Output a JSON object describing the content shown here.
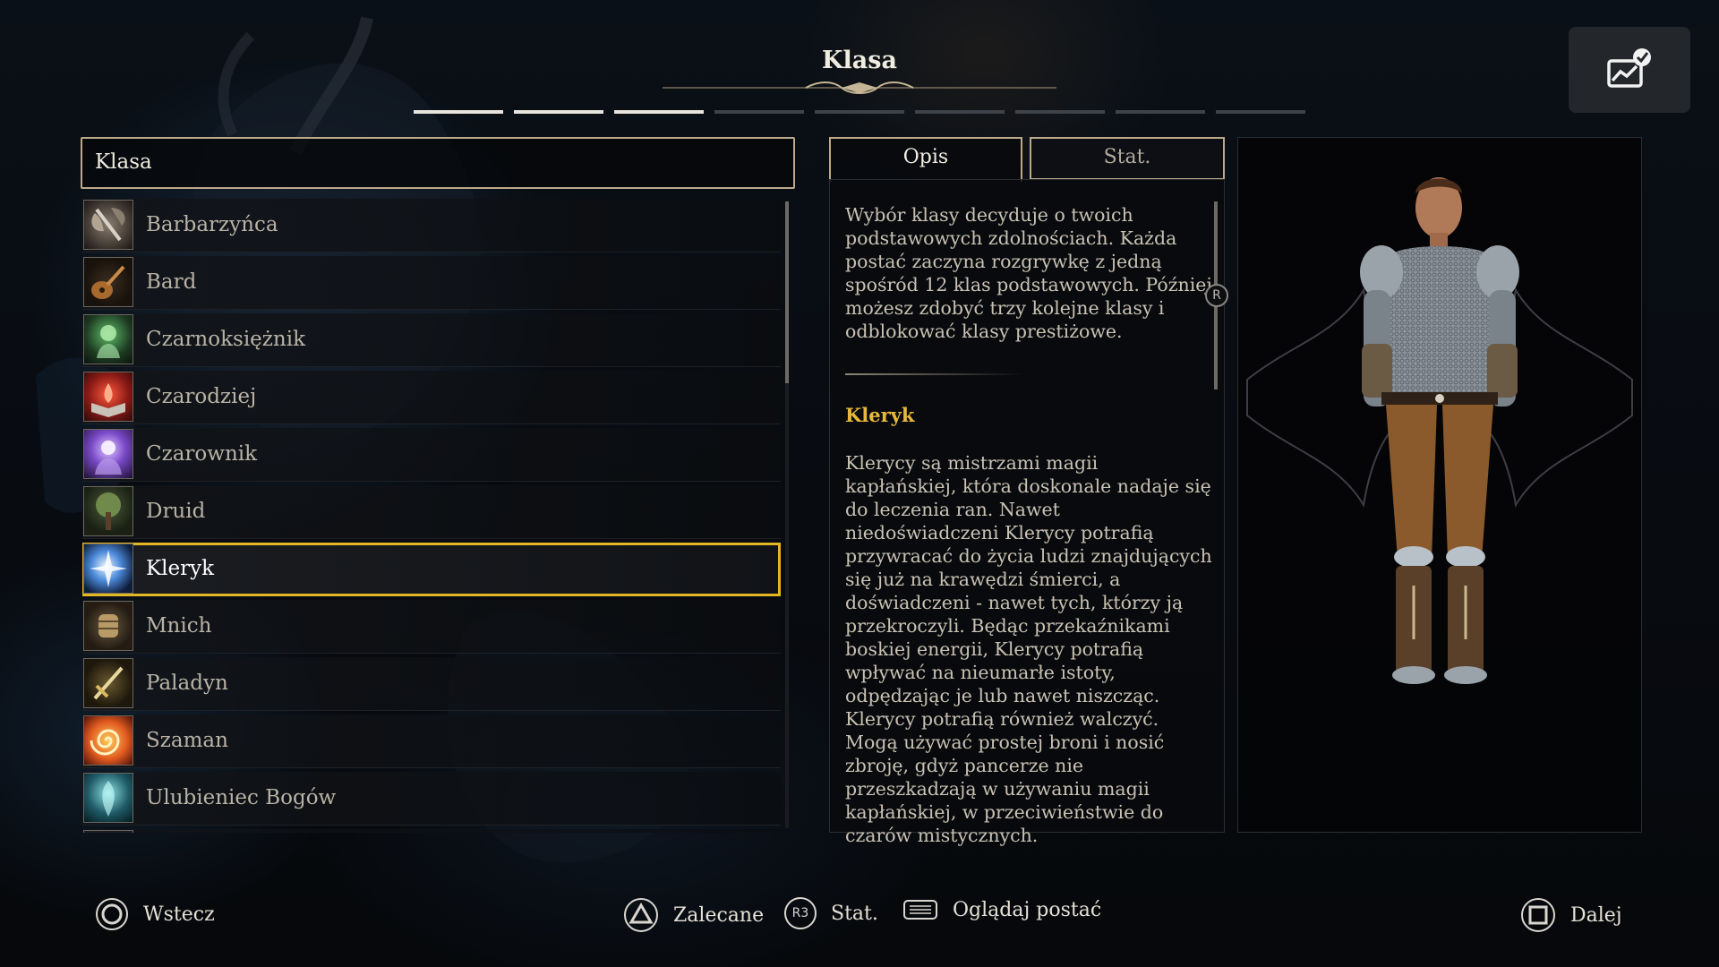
{
  "header": {
    "title": "Klasa",
    "progress_total": 9,
    "progress_done": 3
  },
  "list": {
    "header_label": "Klasa",
    "items": [
      {
        "label": "Barbarzyńca",
        "icon": "axe-icon",
        "selected": false
      },
      {
        "label": "Bard",
        "icon": "lute-icon",
        "selected": false
      },
      {
        "label": "Czarnoksiężnik",
        "icon": "dark-magic-hand-icon",
        "selected": false
      },
      {
        "label": "Czarodziej",
        "icon": "spellbook-icon",
        "selected": false
      },
      {
        "label": "Czarownik",
        "icon": "arcane-hand-icon",
        "selected": false
      },
      {
        "label": "Druid",
        "icon": "tree-icon",
        "selected": false
      },
      {
        "label": "Kleryk",
        "icon": "holy-light-icon",
        "selected": true
      },
      {
        "label": "Mnich",
        "icon": "fist-icon",
        "selected": false
      },
      {
        "label": "Paladyn",
        "icon": "sword-icon",
        "selected": false
      },
      {
        "label": "Szaman",
        "icon": "spiral-icon",
        "selected": false
      },
      {
        "label": "Ulubieniec Bogów",
        "icon": "spirit-icon",
        "selected": false
      }
    ]
  },
  "tabs": {
    "description": "Opis",
    "stats": "Stat."
  },
  "description": {
    "intro": "Wybór klasy decyduje o twoich podstawowych zdolnościach. Każda postać zaczyna rozgrywkę z jedną spośród 12 klas podstawowych. Później możesz zdobyć trzy kolejne klasy i odblokować klasy prestiżowe.",
    "class_name": "Kleryk",
    "class_text": "Klerycy są mistrzami magii kapłańskiej, która doskonale nadaje się do leczenia ran. Nawet niedoświadczeni Klerycy potrafią przywracać do życia ludzi znajdujących się już na krawędzi śmierci, a doświadczeni - nawet tych, którzy ją przekroczyli. Będąc przekaźnikami boskiej energii, Klerycy potrafią wpływać na nieumarłe istoty, odpędzając je lub nawet niszcząc. Klerycy potrafią również walczyć. Mogą używać prostej broni i nosić zbroję, gdyż pancerze nie przeszkadzają w używaniu magii kapłańskiej, w przeciwieństwie do czarów mistycznych.",
    "scroll_badge": "R"
  },
  "footer": {
    "back": {
      "label": "Wstecz",
      "icon": "circle-button-icon"
    },
    "recommended": {
      "label": "Zalecane",
      "icon": "triangle-button-icon"
    },
    "stats": {
      "label": "Stat.",
      "icon": "r3-button-icon",
      "glyph": "R3"
    },
    "view": {
      "label": "Oglądaj postać",
      "icon": "touchpad-icon"
    },
    "next": {
      "label": "Dalej",
      "icon": "square-button-icon"
    }
  },
  "colors": {
    "accent_gold": "#e2b726",
    "class_name": "#e9b83a",
    "frame": "#bca98a"
  }
}
